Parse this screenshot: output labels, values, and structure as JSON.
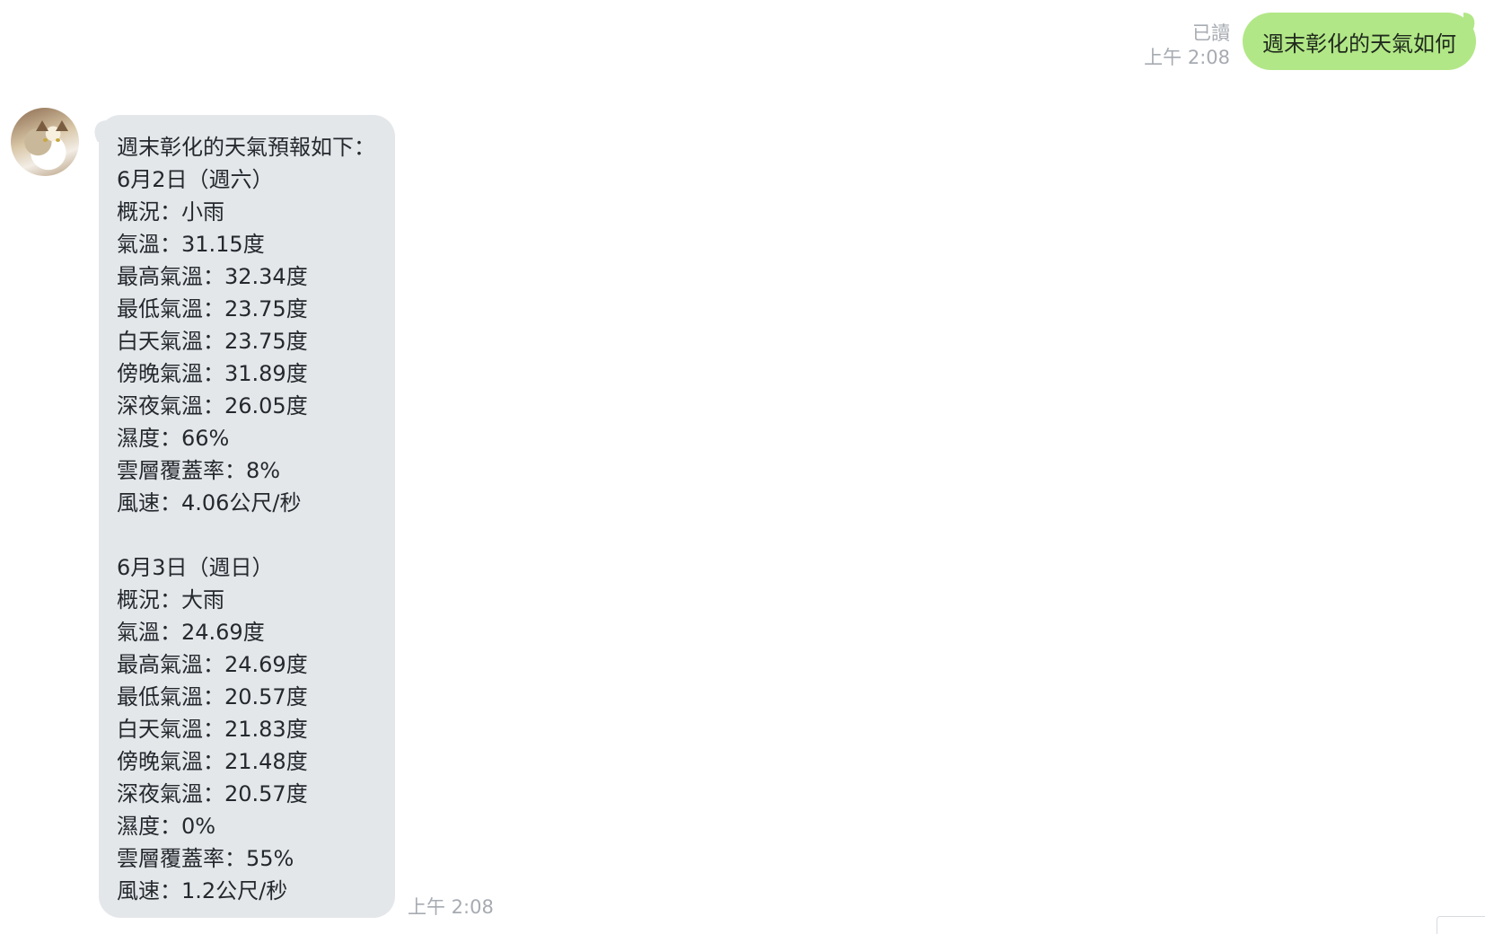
{
  "outgoing": {
    "read_label": "已讀",
    "time": "上午 2:08",
    "text": "週末彰化的天氣如何",
    "bubble_color": "#b2e787"
  },
  "incoming": {
    "bubble_color": "#e4e7ea",
    "time": "上午 2:08",
    "lines": [
      "週末彰化的天氣預報如下：",
      "6月2日（週六）",
      "概況：小雨",
      "氣溫：31.15度",
      "最高氣溫：32.34度",
      "最低氣溫：23.75度",
      "白天氣溫：23.75度",
      "傍晚氣溫：31.89度",
      "深夜氣溫：26.05度",
      "濕度：66%",
      "雲層覆蓋率：8%",
      "風速：4.06公尺/秒",
      "",
      "6月3日（週日）",
      "概況：大雨",
      "氣溫：24.69度",
      "最高氣溫：24.69度",
      "最低氣溫：20.57度",
      "白天氣溫：21.83度",
      "傍晚氣溫：21.48度",
      "深夜氣溫：20.57度",
      "濕度：0%",
      "雲層覆蓋率：55%",
      "風速：1.2公尺/秒"
    ]
  }
}
